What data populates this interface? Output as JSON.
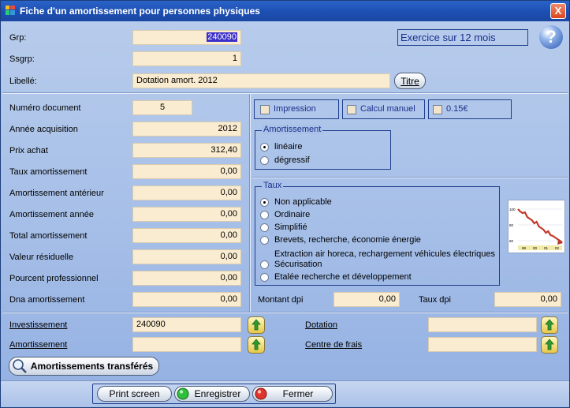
{
  "window": {
    "title": "Fiche d'un amortissement pour personnes physiques",
    "close_glyph": "X"
  },
  "header": {
    "grp_label": "Grp:",
    "grp_value": "240090",
    "ssgrp_label": "Ssgrp:",
    "ssgrp_value": "1",
    "libelle_label": "Libellé:",
    "libelle_value": "Dotation amort. 2012",
    "titre_button": "Titre",
    "exercice": "Exercice sur 12 mois",
    "help_glyph": "?"
  },
  "fields": [
    {
      "label": "Numéro document",
      "value": "5"
    },
    {
      "label": "Année acquisition",
      "value": "2012"
    },
    {
      "label": "Prix achat",
      "value": "312,40"
    },
    {
      "label": "Taux amortissement",
      "value": "0,00"
    },
    {
      "label": "Amortissement antérieur",
      "value": "0,00"
    },
    {
      "label": "Amortissement année",
      "value": "0,00"
    },
    {
      "label": "Total amortissement",
      "value": "0,00"
    },
    {
      "label": "Valeur résiduelle",
      "value": "0,00"
    },
    {
      "label": "Pourcent professionnel",
      "value": "0,00"
    },
    {
      "label": "Dna amortissement",
      "value": "0,00"
    }
  ],
  "options": {
    "impression": "Impression",
    "calcul_manuel": "Calcul manuel",
    "cents": "0.15€"
  },
  "amortissement": {
    "title": "Amortissement",
    "items": [
      "linéaire",
      "dégressif"
    ],
    "selected": 0
  },
  "taux": {
    "title": "Taux",
    "items": [
      "Non applicable",
      "Ordinaire",
      "Simplifié",
      "Brevets, recherche, économie énergie",
      "Extraction air horeca, rechargement véhicules électriques",
      "Sécurisation",
      "Etalée recherche et développement"
    ],
    "selected": 0
  },
  "chart_data": {
    "type": "line",
    "x_ticks": [
      "99",
      "00",
      "01",
      "02"
    ],
    "y_ticks": [
      "100",
      "80",
      "60"
    ],
    "ylim": [
      55,
      105
    ],
    "values": [
      100,
      97,
      95,
      96,
      90,
      88,
      86,
      82,
      84,
      78,
      76,
      74,
      70,
      72,
      67,
      66,
      64,
      62,
      60,
      58
    ],
    "color": "#c0392b"
  },
  "montant_dpi": {
    "label": "Montant dpi",
    "value": "0,00"
  },
  "taux_dpi": {
    "label": "Taux dpi",
    "value": "0,00"
  },
  "bottom": {
    "investissement_label": "Investissement",
    "investissement_value": "240090",
    "amortissement_label": "Amortissement",
    "amortissement_value": "",
    "dotation_label": "Dotation",
    "dotation_value": "",
    "centre_label": "Centre de frais",
    "centre_value": ""
  },
  "buttons": {
    "transferes": "Amortissements transférés",
    "print": "Print screen",
    "save": "Enregistrer",
    "close": "Fermer"
  },
  "colors": {
    "title_bar": "#1d4fb2",
    "field_bg": "#faecd0",
    "window_bg": "#a9c1e8",
    "accent_text": "#1a2f8c"
  }
}
